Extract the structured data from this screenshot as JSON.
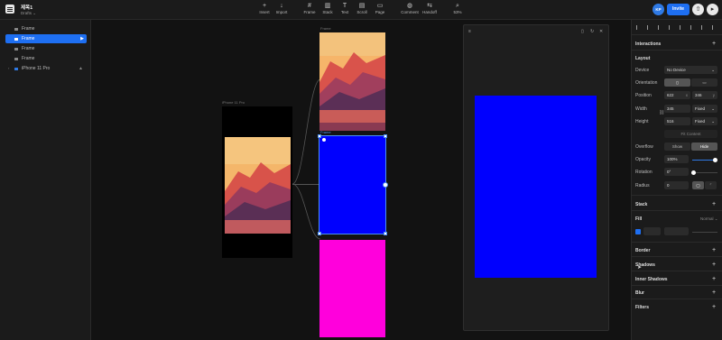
{
  "project": {
    "name": "제목1",
    "subtitle": "Drafts ⌄"
  },
  "toolbar": {
    "insert": "Insert",
    "import": "Import",
    "frame": "Frame",
    "stack": "Stack",
    "text": "Text",
    "scroll": "Scroll",
    "page": "Page",
    "comment": "Comment",
    "handoff": "Handoff",
    "zoom": "53%"
  },
  "user": {
    "initials": "KP",
    "invite": "Invite"
  },
  "layers": [
    {
      "label": "Frame"
    },
    {
      "label": "Frame"
    },
    {
      "label": "Frame"
    },
    {
      "label": "Frame"
    },
    {
      "label": "iPhone 11 Pro"
    }
  ],
  "canvas": {
    "iphone_label": "iPhone 11 Pro",
    "frame_label": "Frame",
    "frame_label_top": "Frame"
  },
  "props": {
    "interactions": "Interactions",
    "layout": "Layout",
    "device_label": "Device",
    "device_value": "No Device",
    "orientation_label": "Orientation",
    "position_label": "Position",
    "pos_x": "622",
    "pos_x_unit": "x",
    "pos_y": "346",
    "pos_y_unit": "y",
    "width_label": "Width",
    "width_value": "345",
    "width_mode": "Fixed",
    "height_label": "Height",
    "height_value": "516",
    "height_mode": "Fixed",
    "fit_content": "Fit Content",
    "overflow_label": "Overflow",
    "overflow_show": "Show",
    "overflow_hide": "Hide",
    "opacity_label": "Opacity",
    "opacity_value": "100%",
    "rotation_label": "Rotation",
    "rotation_value": "0°",
    "radius_label": "Radius",
    "radius_value": "0",
    "stack": "Stack",
    "fill": "Fill",
    "fill_mode": "Normal",
    "border": "Border",
    "shadows": "Shadows",
    "inner_shadows": "Inner Shadows",
    "blur": "Blur",
    "filters": "Filters"
  },
  "colors": {
    "accent": "#1e6ff2",
    "frame_blue": "#0000fe",
    "frame_magenta": "#ff00dc"
  }
}
